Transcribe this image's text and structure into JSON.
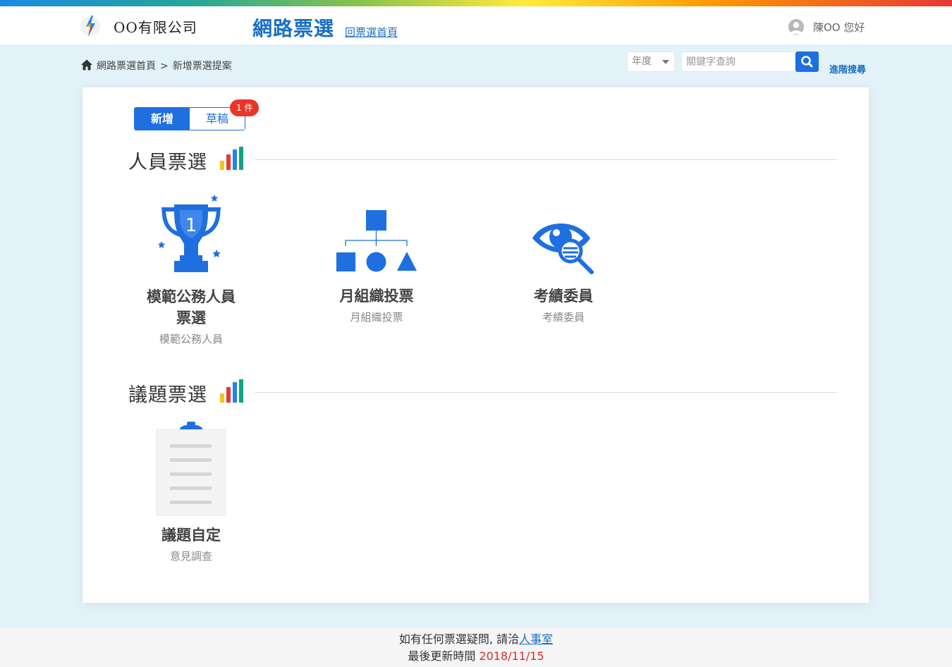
{
  "header": {
    "company": "OO有限公司",
    "system_title": "網路票選",
    "home_link": "回票選首頁",
    "user_greeting": "陳OO 您好"
  },
  "breadcrumb": {
    "home": "網路票選首頁",
    "separator": ">",
    "current": "新增票選提案"
  },
  "search": {
    "year_label": "年度",
    "placeholder": "關鍵字查詢",
    "advanced": "進階搜尋"
  },
  "tabs": {
    "new": "新增",
    "draft": "草稿",
    "draft_badge": "1 件"
  },
  "sections": {
    "personnel": {
      "title": "人員票選",
      "items": [
        {
          "title_line1": "模範公務人員",
          "title_line2": "票選",
          "subtitle": "模範公務人員",
          "icon": "trophy-icon"
        },
        {
          "title": "月組織投票",
          "subtitle": "月組織投票",
          "icon": "org-chart-icon"
        },
        {
          "title": "考績委員",
          "subtitle": "考績委員",
          "icon": "eye-search-icon"
        }
      ]
    },
    "topic": {
      "title": "議題票選",
      "items": [
        {
          "title": "議題自定",
          "subtitle": "意見調查",
          "icon": "clipboard-icon"
        }
      ]
    }
  },
  "footer": {
    "line1_prefix": "如有任何票選疑問, 請洽",
    "line1_link": "人事室",
    "line2_prefix": "最後更新時間 ",
    "line2_date": "2018/11/15"
  },
  "colors": {
    "primary": "#1f6fe0",
    "badge": "#e8362b",
    "date": "#d32f2f",
    "page_bg": "#e3f2f9"
  }
}
